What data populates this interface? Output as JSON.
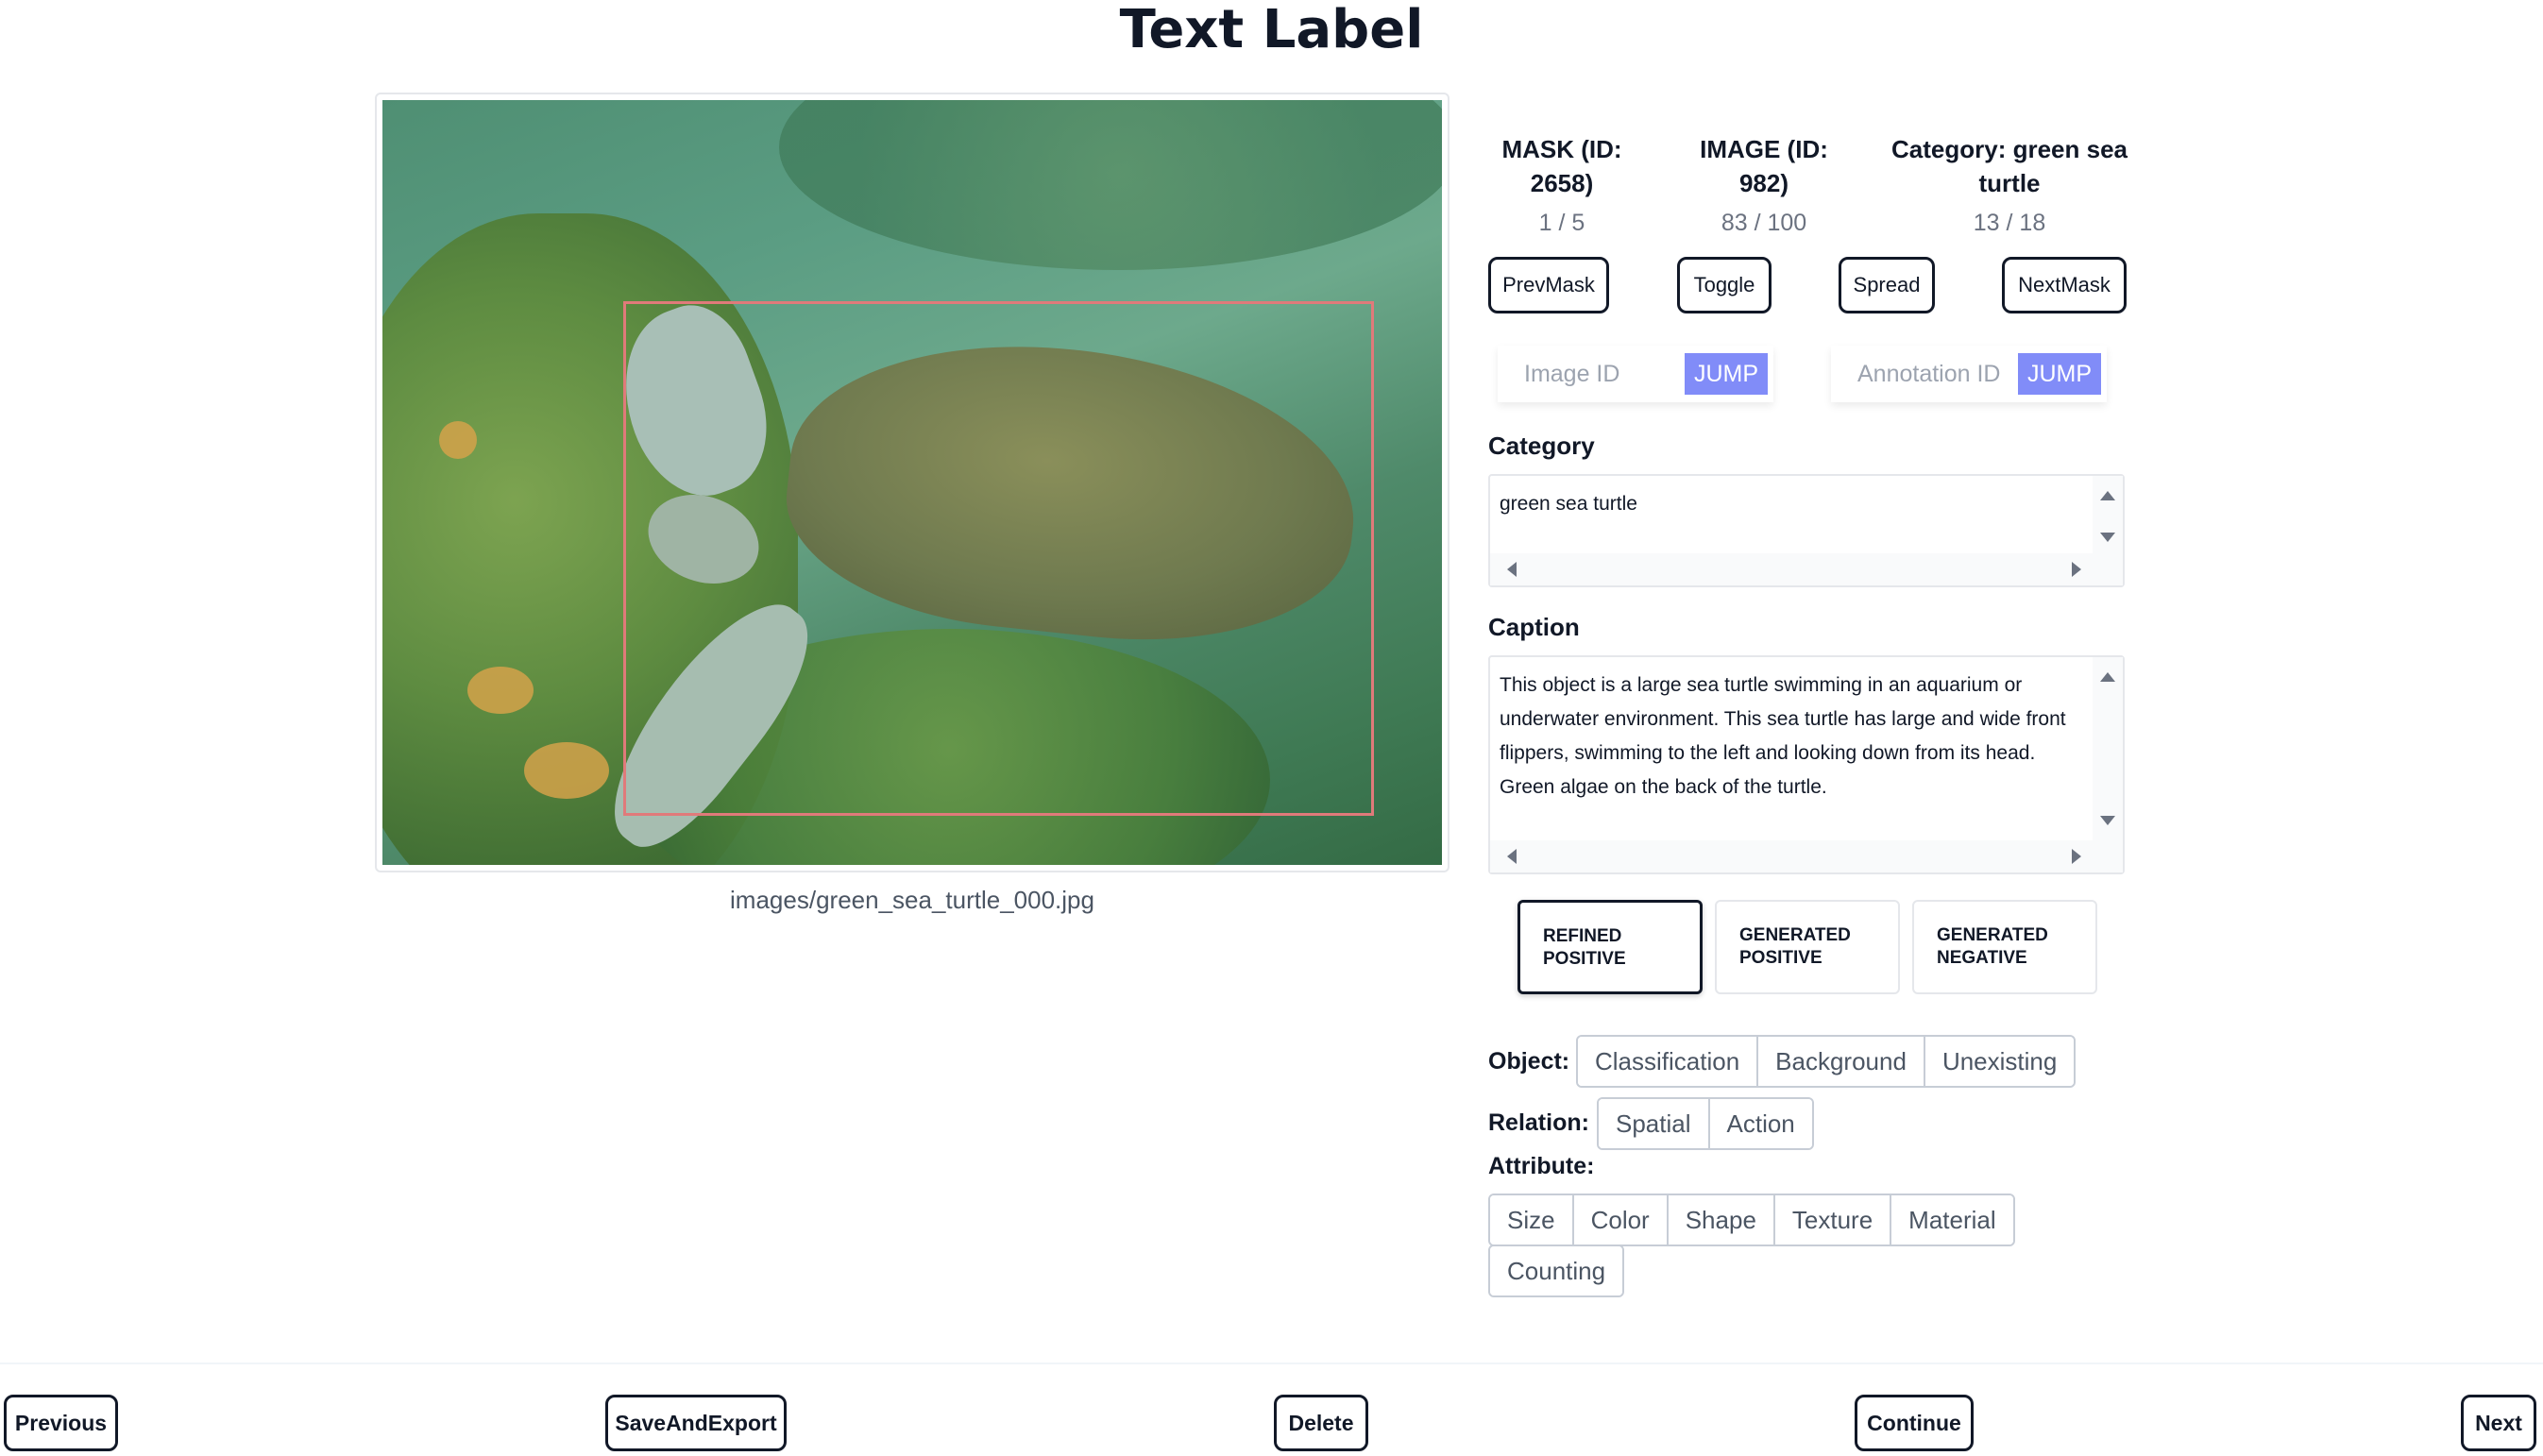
{
  "page": {
    "title": "Text Label"
  },
  "image": {
    "path": "images/green_sea_turtle_000.jpg",
    "bbox_color": "#e07a7a"
  },
  "info": {
    "mask": {
      "title": "MASK (ID: 2658)",
      "count": "1 / 5"
    },
    "image": {
      "title": "IMAGE (ID: 982)",
      "count": "83 / 100"
    },
    "category": {
      "title": "Category: green sea turtle",
      "count": "13 / 18"
    }
  },
  "mask_buttons": {
    "prev": "PrevMask",
    "toggle": "Toggle",
    "spread": "Spread",
    "next": "NextMask"
  },
  "jump": {
    "image_placeholder": "Image ID",
    "annotation_placeholder": "Annotation ID",
    "button_label": "JUMP",
    "accent": "#818cf8"
  },
  "category_field": {
    "label": "Category",
    "value": "green sea turtle"
  },
  "caption_field": {
    "label": "Caption",
    "value": "This object is a large sea turtle swimming in an aquarium or underwater environment. This sea turtle has large and wide front flippers, swimming to the left and looking down from its head. Green algae on the back of the turtle."
  },
  "caption_types": [
    {
      "line1": "REFINED",
      "line2": "POSITIVE",
      "selected": true
    },
    {
      "line1": "GENERATED",
      "line2": "POSITIVE",
      "selected": false
    },
    {
      "line1": "GENERATED",
      "line2": "NEGATIVE",
      "selected": false
    }
  ],
  "tags": {
    "object": {
      "label": "Object:",
      "items": [
        "Classification",
        "Background",
        "Unexisting"
      ]
    },
    "relation": {
      "label": "Relation:",
      "items": [
        "Spatial",
        "Action"
      ]
    },
    "attribute": {
      "label": "Attribute:",
      "items": [
        "Size",
        "Color",
        "Shape",
        "Texture",
        "Material",
        "Counting"
      ]
    }
  },
  "footer": {
    "previous": "Previous",
    "save": "SaveAndExport",
    "delete": "Delete",
    "continue": "Continue",
    "next": "Next"
  }
}
